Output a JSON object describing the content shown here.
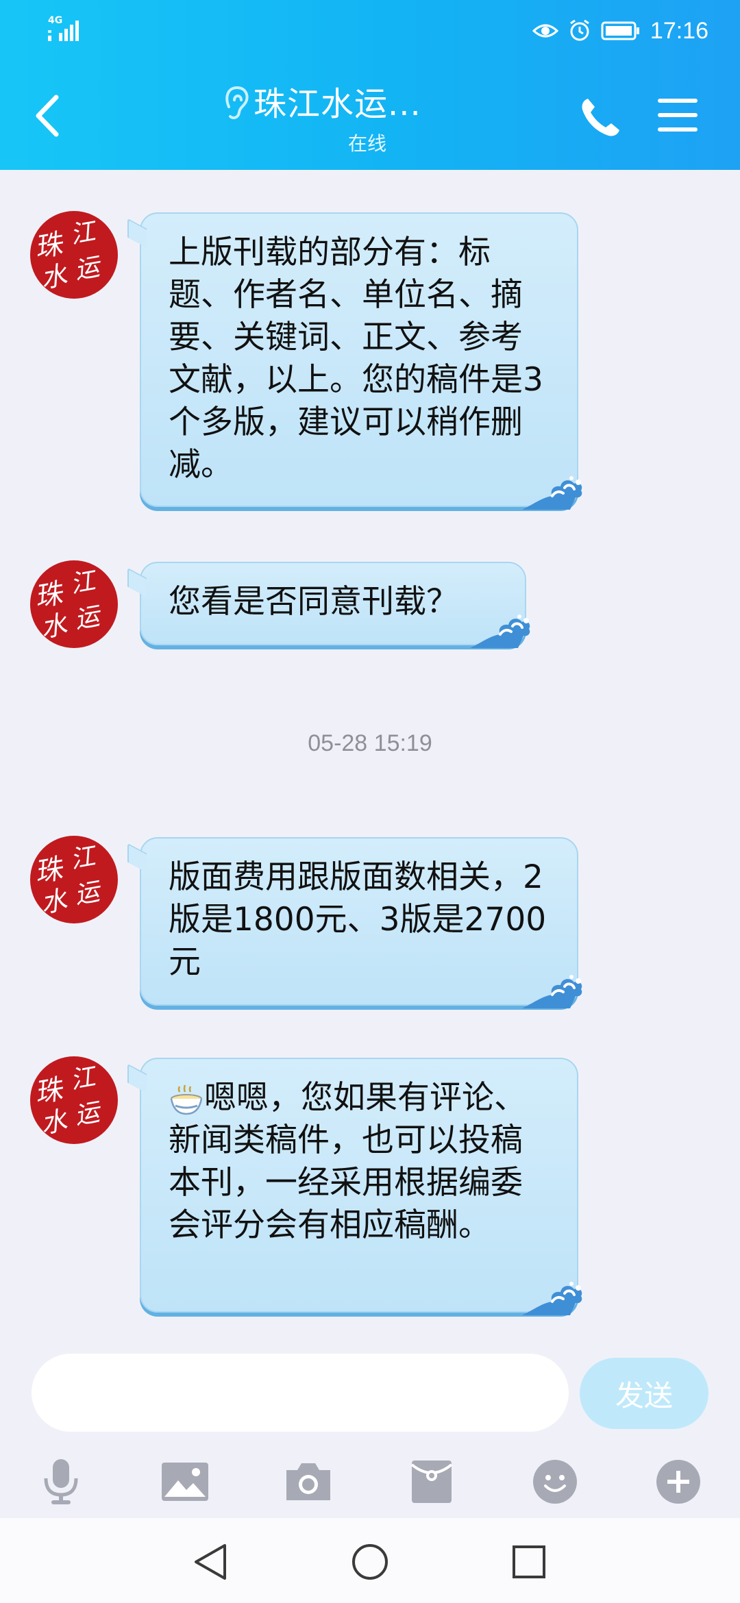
{
  "status_bar": {
    "network": "4G",
    "time": "17:16"
  },
  "header": {
    "title": "珠江水运...",
    "subtitle": "在线"
  },
  "contact": {
    "avatar_text": "珠江水运"
  },
  "messages": [
    {
      "text": "上版刊载的部分有：标题、作者名、单位名、摘要、关键词、正文、参考文献，以上。您的稿件是3个多版，建议可以稍作删减。"
    },
    {
      "text": "您看是否同意刊载？"
    },
    {
      "text": "版面费用跟版面数相关，2版是1800元、3版是2700元"
    },
    {
      "text": "嗯嗯，您如果有评论、新闻类稿件，也可以投稿本刊，一经采用根据编委会评分会有相应稿酬。"
    }
  ],
  "timestamp": "05-28 15:19",
  "input": {
    "value": "",
    "placeholder": "",
    "send_label": "发送"
  },
  "toolbar": {
    "icons": [
      "microphone-icon",
      "image-icon",
      "camera-icon",
      "red-packet-icon",
      "emoji-icon",
      "plus-icon"
    ]
  },
  "colors": {
    "header_start": "#17c6f7",
    "header_end": "#1ea2f4",
    "bubble": "#c9e8fa",
    "background": "#f0f1f8",
    "avatar": "#c01a1f",
    "send_button": "#bfe9fb"
  }
}
